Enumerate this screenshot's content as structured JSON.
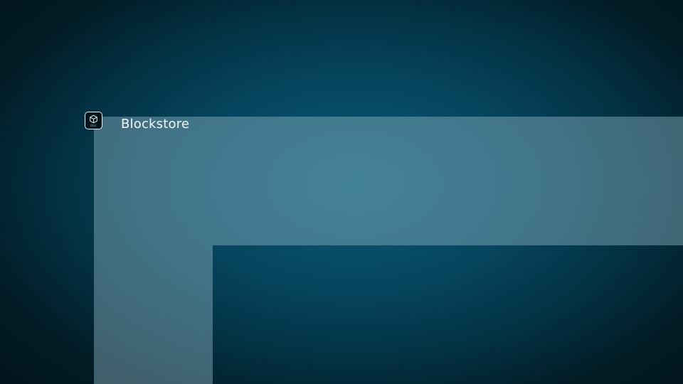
{
  "app": {
    "title": "Blockstore",
    "icon": "cube-icon",
    "tile_caption": "Bloc"
  },
  "colors": {
    "background_center": "#0a5a78",
    "background_edge": "#01141c",
    "overlay": "#8cb4c3",
    "title_text": "#f2f6f8"
  }
}
